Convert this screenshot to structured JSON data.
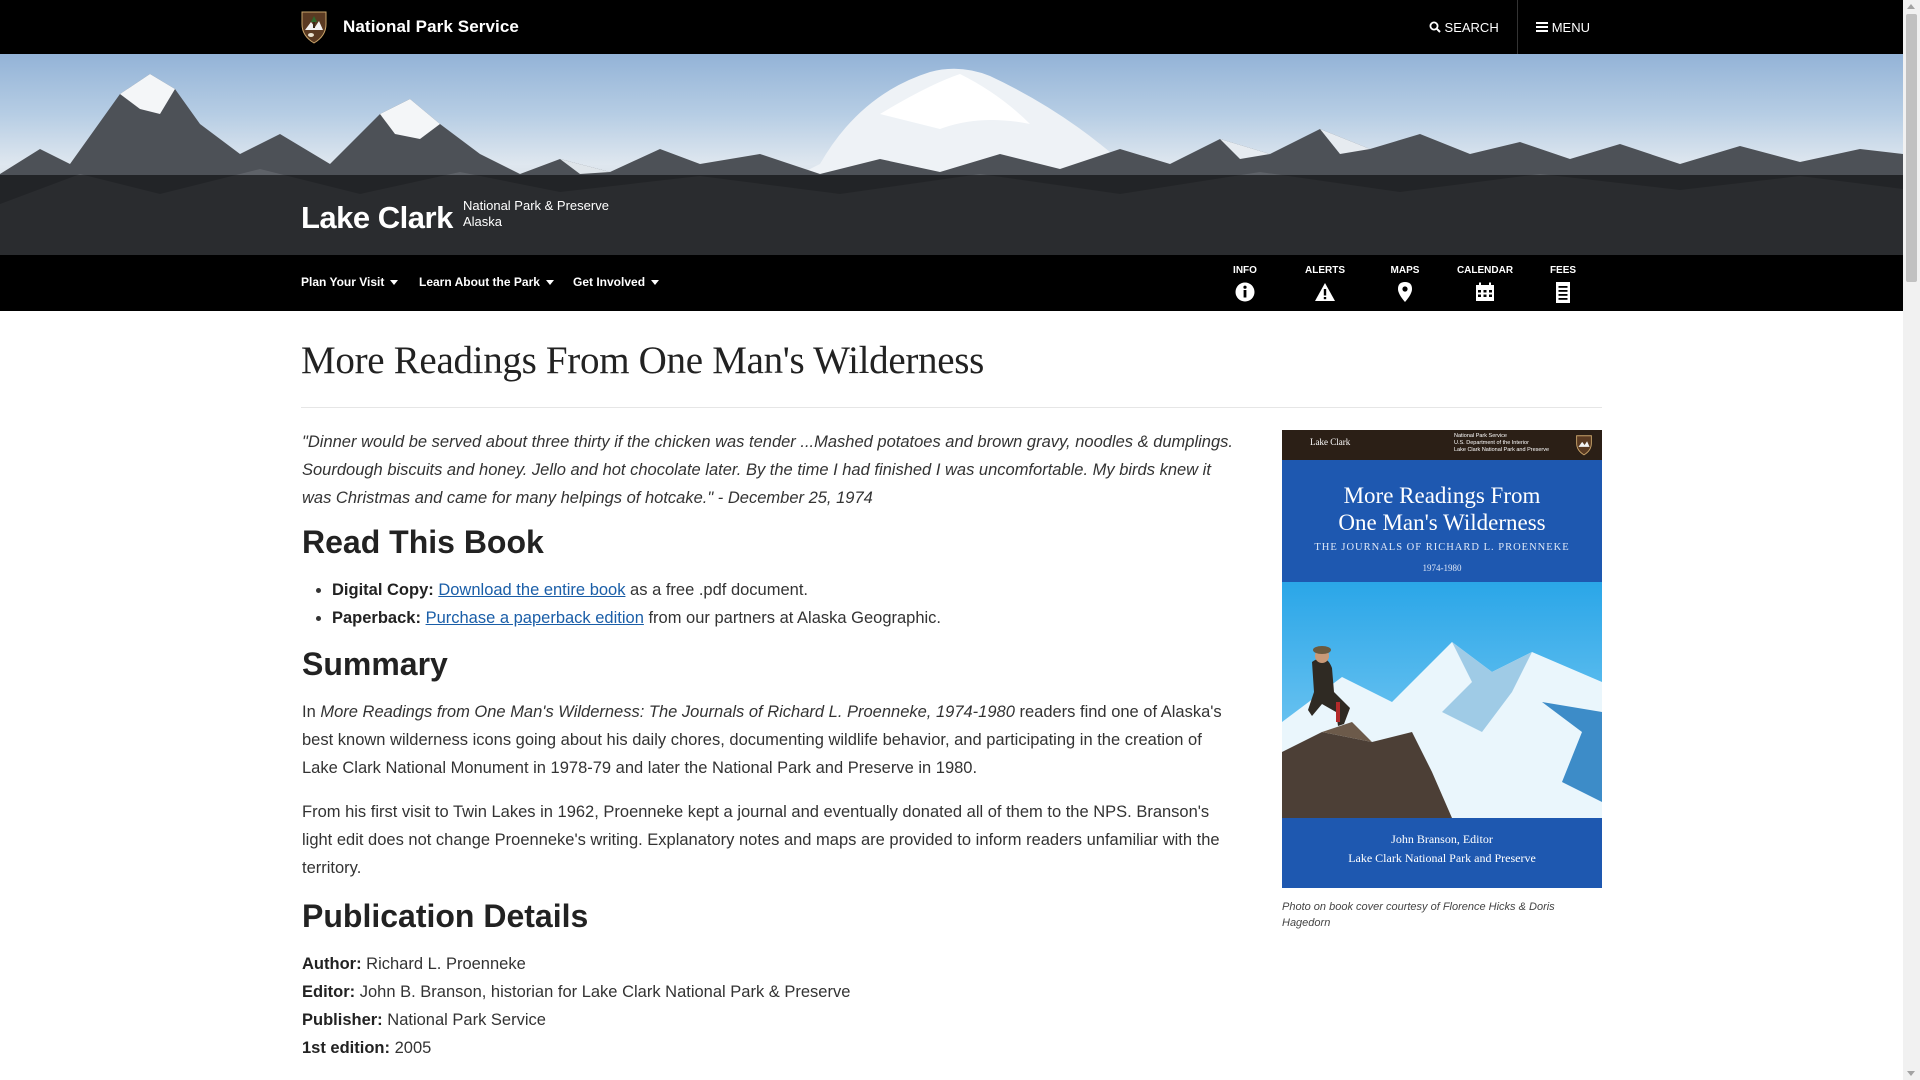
{
  "header": {
    "brand": "National Park Service",
    "search_label": "SEARCH",
    "menu_label": "MENU"
  },
  "banner": {
    "park_name": "Lake Clark",
    "designation": "National Park & Preserve",
    "state": "Alaska"
  },
  "nav": {
    "items": [
      {
        "label": "Plan Your Visit"
      },
      {
        "label": "Learn About the Park"
      },
      {
        "label": "Get Involved"
      }
    ],
    "icons": [
      {
        "label": "INFO",
        "icon": "info-icon"
      },
      {
        "label": "ALERTS",
        "icon": "alert-icon"
      },
      {
        "label": "MAPS",
        "icon": "map-pin-icon"
      },
      {
        "label": "CALENDAR",
        "icon": "calendar-icon"
      },
      {
        "label": "FEES",
        "icon": "receipt-icon"
      }
    ]
  },
  "page": {
    "title": "More Readings From One Man's Wilderness",
    "quote": "\"Dinner would be served about three thirty if the chicken was tender ...Mashed potatoes and brown gravy, noodles & dumplings. Sourdough biscuits and honey. Jello and hot chocolate later. By the time I had finished I was uncomfortable. My birds knew it was Christmas and came for many helpings of hotcake.\" - December 25, 1974",
    "read_heading": "Read This Book",
    "read_items": [
      {
        "label": "Digital Copy:",
        "link": "Download the entire book",
        "after": " as a free .pdf document."
      },
      {
        "label": "Paperback:",
        "link": "Purchase a paperback edition",
        "after": " from our partners at Alaska Geographic."
      }
    ],
    "summary_heading": "Summary",
    "summary_p1_pre": "In ",
    "summary_p1_italic": "More Readings from One Man's Wilderness: The Journals of Richard L. Proenneke, 1974-1980",
    "summary_p1_post": " readers find one of Alaska's best known wilderness icons going about his daily chores, documenting wildlife behavior, and participating in the creation of Lake Clark National Monument in 1978-79 and later the National Park and Preserve in 1980.",
    "summary_p2": "From his first visit to Twin Lakes in 1962, Proenneke kept a journal and eventually donated all of them to the NPS. Branson's light edit does not change Proenneke's writing. Explanatory notes and maps are provided to inform readers unfamiliar with the territory.",
    "pub_heading": "Publication Details",
    "pub": [
      {
        "label": "Author:",
        "value": " Richard L. Proenneke"
      },
      {
        "label": "Editor:",
        "value": " John B. Branson, historian for Lake Clark National Park & Preserve"
      },
      {
        "label": "Publisher:",
        "value": " National Park Service"
      },
      {
        "label": "1st edition:",
        "value": " 2005"
      }
    ]
  },
  "cover": {
    "park": "Lake Clark",
    "agency_lines": [
      "National Park Service",
      "U.S. Department of the Interior",
      "Lake Clark National Park and Preserve"
    ],
    "title_line1": "More Readings From",
    "title_line2": "One Man's Wilderness",
    "subtitle": "THE JOURNALS OF RICHARD L. PROENNEKE",
    "years": "1974-1980",
    "editor": "John Branson, Editor",
    "publisher": "Lake Clark National Park and Preserve",
    "caption": "Photo on book cover courtesy of Florence Hicks & Doris Hagedorn"
  }
}
